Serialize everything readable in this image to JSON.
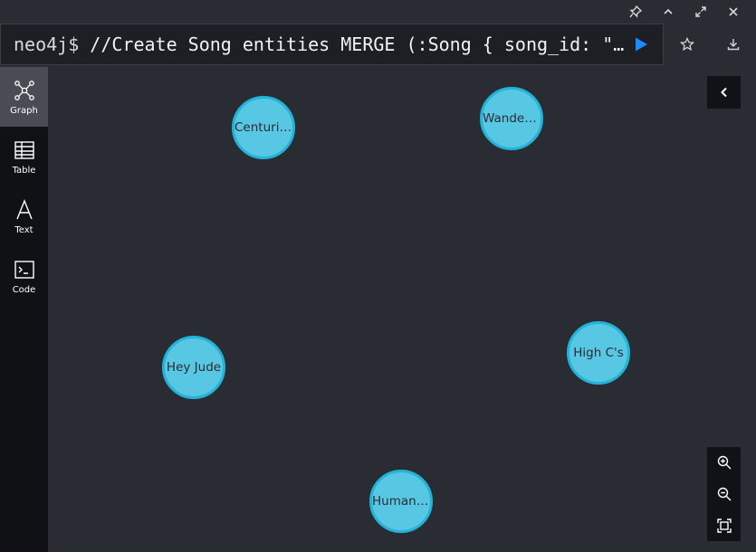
{
  "window_controls": [
    {
      "name": "pin-icon"
    },
    {
      "name": "chevron-up-icon"
    },
    {
      "name": "expand-icon"
    },
    {
      "name": "close-icon"
    }
  ],
  "query": {
    "prompt": "neo4j$ ",
    "text": "//Create Song entities MERGE (:Song { song_id: \"S…"
  },
  "top_actions": [
    {
      "name": "star-icon"
    },
    {
      "name": "download-icon"
    }
  ],
  "sidebar": {
    "items": [
      {
        "label": "Graph",
        "icon": "graph-icon",
        "active": true
      },
      {
        "label": "Table",
        "icon": "table-icon",
        "active": false
      },
      {
        "label": "Text",
        "icon": "text-icon",
        "active": false
      },
      {
        "label": "Code",
        "icon": "code-icon",
        "active": false
      }
    ]
  },
  "graph": {
    "nodes": [
      {
        "label": "Centuries"
      },
      {
        "label": "Wanderi…"
      },
      {
        "label": "Hey Jude"
      },
      {
        "label": "High C's"
      },
      {
        "label": "Humanity"
      }
    ]
  },
  "colors": {
    "node_fill": "#57c7e3",
    "node_border": "#23b3d7",
    "run_button": "#1a8cff",
    "background": "#292c33"
  }
}
